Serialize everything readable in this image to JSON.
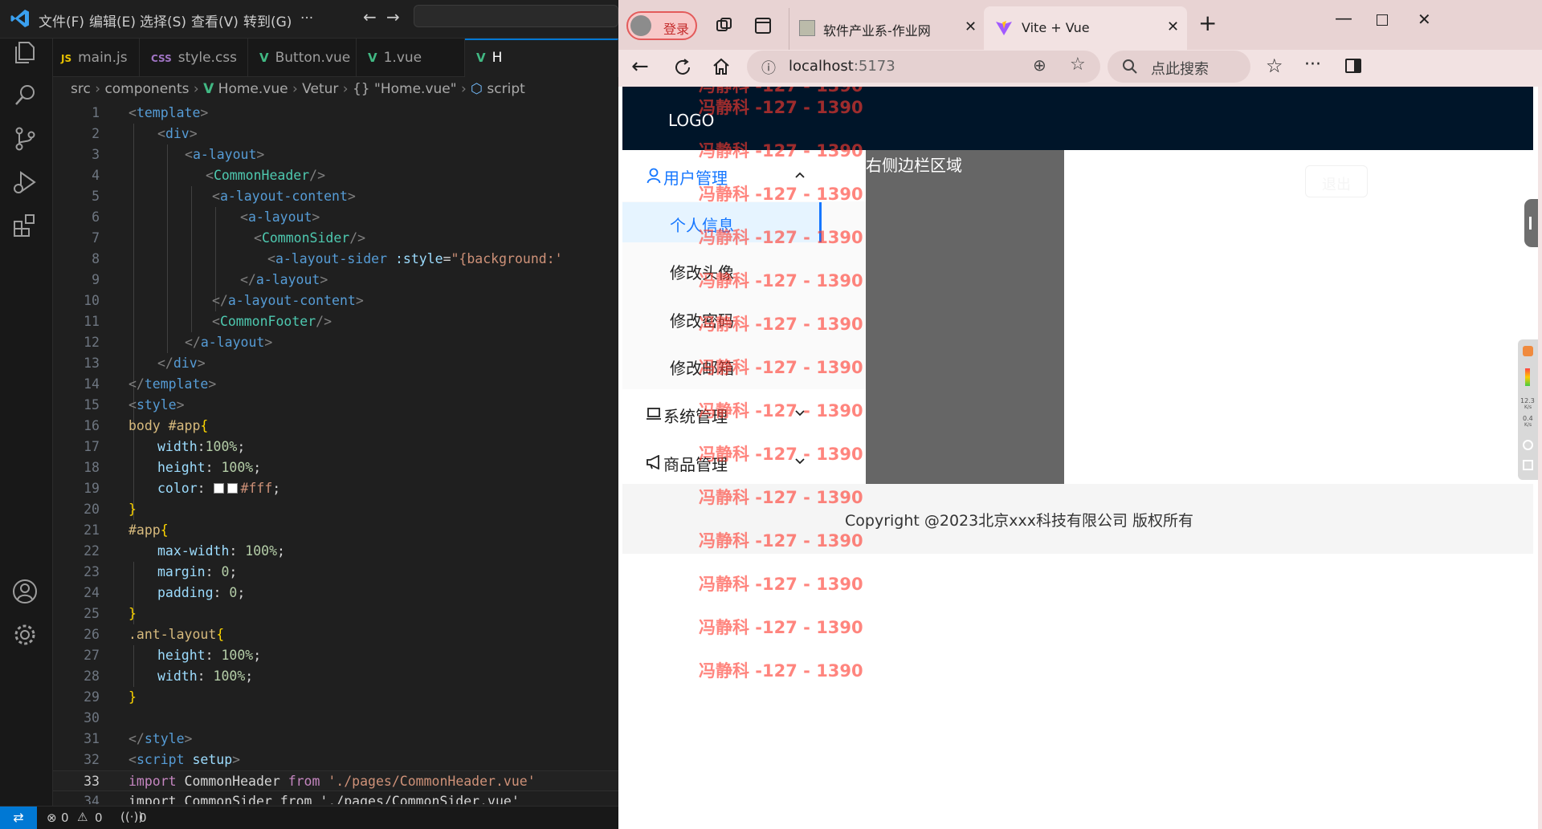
{
  "vscode": {
    "menu": [
      "文件(F)",
      "编辑(E)",
      "选择(S)",
      "查看(V)",
      "转到(G)",
      "···"
    ],
    "tabs": [
      "main.js",
      "style.css",
      "Button.vue",
      "1.vue",
      "H"
    ],
    "tab_icons": [
      "JS",
      "CSS",
      "V",
      "V",
      "V"
    ],
    "breadcrumb": [
      "src",
      "components",
      "Home.vue",
      "Vetur",
      "{} \"Home.vue\"",
      "script"
    ],
    "line_numbers": [
      "1",
      "2",
      "3",
      "4",
      "5",
      "6",
      "7",
      "8",
      "9",
      "10",
      "11",
      "12",
      "13",
      "14",
      "15",
      "16",
      "17",
      "18",
      "19",
      "20",
      "21",
      "22",
      "23",
      "24",
      "25",
      "26",
      "27",
      "28",
      "29",
      "30",
      "31",
      "32",
      "33",
      "34"
    ],
    "code": {
      "l1": "template",
      "l2": "div",
      "l3": "a-layout",
      "l4": "CommonHeader",
      "l5": "a-layout-content",
      "l6": "a-layout",
      "l7": "CommonSider",
      "l8_tag": "a-layout-sider",
      "l8_attr": " :style",
      "l8_val": "\"{background:'",
      "l9": "a-layout",
      "l10": "a-layout-content",
      "l11": "CommonFooter",
      "l12": "a-layout",
      "l13": "div",
      "l14": "template",
      "l15": "style",
      "l16_sel": "body #app",
      "l17_prop": "width",
      "l17_val": "100%",
      "l18_prop": "height",
      "l18_val": " 100%",
      "l19_prop": "color",
      "l19_val": "#fff",
      "l21_sel": "#app",
      "l22_prop": "max-width",
      "l22_val": " 100%",
      "l23_prop": "margin",
      "l23_val": " 0",
      "l24_prop": "padding",
      "l24_val": " 0",
      "l26_sel": ".ant-layout",
      "l27_prop": "height",
      "l27_val": " 100%",
      "l28_prop": "width",
      "l28_val": " 100%",
      "l31": "style",
      "l32_tag": "script",
      "l32_attr": " setup",
      "l33_kw": "import",
      "l33_name": " CommonHeader ",
      "l33_from": "from",
      "l33_path": " './pages/CommonHeader.vue'",
      "l34": "import CommonSider from './pages/CommonSider.vue'"
    },
    "status": {
      "errors": "0",
      "warnings": "0",
      "ports": "0"
    }
  },
  "browser": {
    "profile_label": "登录",
    "tabs": [
      {
        "title": "软件产业系-作业网",
        "active": false
      },
      {
        "title": "Vite + Vue",
        "active": true
      }
    ],
    "address": "localhost",
    "address_port": ":5173",
    "search_placeholder": "点此搜索",
    "app": {
      "logo": "LOGO",
      "right_area_label": "右侧边栏区域",
      "logout_label": "退出",
      "menu": {
        "user_group": "用户管理",
        "user_items": [
          "个人信息",
          "修改头像",
          "修改密码",
          "修改邮箱"
        ],
        "system_group": "系统管理",
        "product_group": "商品管理"
      },
      "footer": "Copyright @2023北京xxx科技有限公司 版权所有"
    },
    "watermark": "冯静科 -127 - 1390",
    "side_widget": [
      "12.3",
      "K/s",
      "0.4",
      "K/s"
    ]
  },
  "colors": {
    "vscode_bg": "#1f1f1f",
    "accent_blue": "#1677ff",
    "header_dark": "#001529",
    "watermark_red": "#ff3b30",
    "sider_gray": "#666666"
  }
}
